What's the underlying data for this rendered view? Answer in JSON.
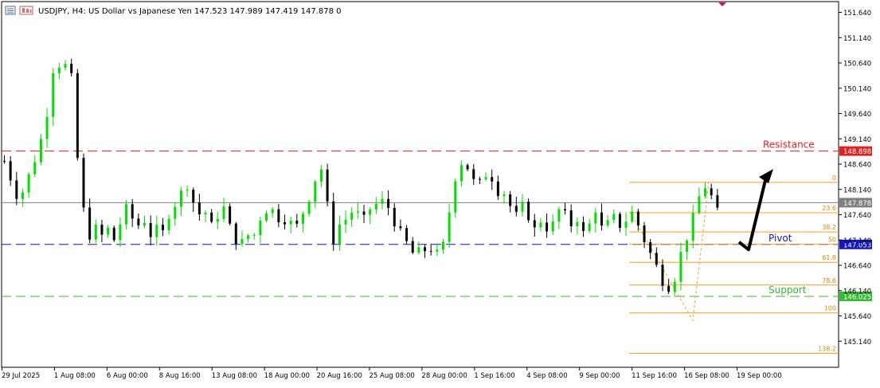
{
  "header": {
    "symbol_line": "USDJPY, H4:  US Dollar vs Japanese Yen  147.523 147.989 147.419 147.878  0",
    "icon_names": [
      "chart-window-icon",
      "chart-type-icon"
    ]
  },
  "chart_data": {
    "type": "candlestick",
    "symbol": "USDJPY",
    "timeframe": "H4",
    "ylim": [
      144.8,
      151.75
    ],
    "price_ticks": [
      "151.640",
      "151.140",
      "150.640",
      "150.140",
      "149.640",
      "149.140",
      "148.640",
      "148.140",
      "147.640",
      "147.140",
      "146.640",
      "146.140",
      "145.640",
      "145.140"
    ],
    "time_ticks": [
      "29 Jul 2025",
      "1 Aug 08:00",
      "6 Aug 00:00",
      "8 Aug 16:00",
      "13 Aug 08:00",
      "18 Aug 00:00",
      "20 Aug 16:00",
      "25 Aug 08:00",
      "28 Aug 00:00",
      "1 Sep 16:00",
      "4 Sep 08:00",
      "9 Sep 00:00",
      "11 Sep 16:00",
      "16 Sep 08:00",
      "19 Sep 00:00"
    ],
    "colors": {
      "bull": "#00e000",
      "bear": "#000000",
      "resistance": "#dd2222",
      "pivot": "#1515c8",
      "support": "#33bb33",
      "fib": "#f0a020",
      "current": "#808080"
    },
    "close_path": [
      [
        0,
        148.7
      ],
      [
        1.2,
        147.9
      ],
      [
        2,
        148.4
      ],
      [
        2.8,
        148.9
      ],
      [
        3.5,
        149.6
      ],
      [
        4,
        150.5
      ],
      [
        4.5,
        150.6
      ],
      [
        5,
        150.6
      ],
      [
        5.5,
        150.5
      ],
      [
        6.1,
        148.6
      ],
      [
        6.5,
        147.8
      ],
      [
        7,
        147.2
      ],
      [
        7.5,
        147.4
      ],
      [
        8,
        147.2
      ],
      [
        8.5,
        147.4
      ],
      [
        9,
        147.1
      ],
      [
        9.5,
        147.4
      ],
      [
        10,
        147.8
      ],
      [
        10.5,
        147.6
      ],
      [
        11,
        147.4
      ],
      [
        11.5,
        147.6
      ],
      [
        12,
        147.2
      ],
      [
        12.5,
        147.4
      ],
      [
        13,
        147.2
      ],
      [
        13.5,
        147.6
      ],
      [
        14,
        147.8
      ],
      [
        14.5,
        148.0
      ],
      [
        15,
        148.3
      ],
      [
        15.5,
        148.0
      ],
      [
        16,
        147.6
      ],
      [
        16.5,
        147.8
      ],
      [
        17,
        147.4
      ],
      [
        17.5,
        147.5
      ],
      [
        18,
        147.9
      ],
      [
        18.5,
        147.5
      ],
      [
        19,
        147.2
      ],
      [
        19.5,
        147.0
      ],
      [
        20,
        147.3
      ],
      [
        20.5,
        147.1
      ],
      [
        21,
        147.5
      ],
      [
        21.5,
        147.7
      ],
      [
        22,
        147.8
      ],
      [
        22.5,
        147.6
      ],
      [
        23,
        147.5
      ],
      [
        23.5,
        147.6
      ],
      [
        24,
        147.3
      ],
      [
        24.5,
        147.6
      ],
      [
        25,
        147.8
      ],
      [
        25.5,
        148.2
      ],
      [
        26,
        148.5
      ],
      [
        26.5,
        148.6
      ],
      [
        27,
        146.9
      ],
      [
        27.5,
        147.4
      ],
      [
        28,
        147.5
      ],
      [
        28.5,
        147.6
      ],
      [
        29,
        147.8
      ],
      [
        29.5,
        147.5
      ],
      [
        30,
        147.6
      ],
      [
        30.5,
        147.9
      ],
      [
        31,
        147.8
      ],
      [
        31.5,
        148.0
      ],
      [
        32,
        147.6
      ],
      [
        32.5,
        147.4
      ],
      [
        33,
        147.2
      ],
      [
        33.5,
        147.0
      ],
      [
        34,
        146.8
      ],
      [
        34.5,
        147.0
      ],
      [
        35,
        146.9
      ],
      [
        35.5,
        147.0
      ],
      [
        36,
        146.8
      ],
      [
        36.5,
        147.2
      ],
      [
        37,
        148.0
      ],
      [
        37.5,
        148.6
      ],
      [
        38,
        148.7
      ],
      [
        38.5,
        148.5
      ],
      [
        39,
        148.2
      ],
      [
        39.5,
        148.3
      ],
      [
        40,
        148.5
      ],
      [
        40.5,
        148.3
      ],
      [
        41,
        148.0
      ],
      [
        41.5,
        148.1
      ],
      [
        42,
        147.7
      ],
      [
        42.5,
        147.6
      ],
      [
        43,
        147.9
      ],
      [
        43.5,
        147.5
      ],
      [
        44,
        147.3
      ],
      [
        44.5,
        147.6
      ],
      [
        45,
        147.3
      ],
      [
        45.5,
        147.5
      ],
      [
        46,
        147.8
      ],
      [
        46.5,
        147.6
      ],
      [
        47,
        147.4
      ],
      [
        47.5,
        147.6
      ],
      [
        48,
        147.2
      ],
      [
        48.5,
        147.5
      ],
      [
        49,
        147.8
      ],
      [
        49.5,
        147.3
      ],
      [
        50,
        147.5
      ],
      [
        50.5,
        147.6
      ],
      [
        51,
        147.4
      ],
      [
        52,
        147.7
      ],
      [
        53,
        147.1
      ],
      [
        54,
        146.6
      ],
      [
        54.5,
        146.3
      ],
      [
        55,
        146.2
      ],
      [
        55.5,
        146.4
      ],
      [
        56,
        146.9
      ],
      [
        56.5,
        147.2
      ],
      [
        57,
        147.6
      ],
      [
        57.5,
        148.0
      ],
      [
        58,
        148.2
      ],
      [
        58.5,
        148.0
      ],
      [
        59,
        147.7
      ]
    ],
    "levels": [
      {
        "name": "resistance",
        "label": "Resistance",
        "price": 148.898,
        "value_text": "148.898"
      },
      {
        "name": "pivot",
        "label": "Pivot",
        "price": 147.053,
        "value_text": "147.053"
      },
      {
        "name": "support",
        "label": "Support",
        "price": 146.025,
        "value_text": "146.025"
      }
    ],
    "current_price": {
      "price": 147.878,
      "value_text": "147.878"
    },
    "fibonacci": {
      "swing_high": 148.28,
      "swing_low": 145.55,
      "levels": [
        {
          "label": "0",
          "price": 148.28
        },
        {
          "label": "23.6",
          "price": 147.68
        },
        {
          "label": "38.2",
          "price": 147.3
        },
        {
          "label": "50",
          "price": 147.06
        },
        {
          "label": "61.8",
          "price": 146.7
        },
        {
          "label": "78.6",
          "price": 146.25
        },
        {
          "label": "100",
          "price": 145.7
        },
        {
          "label": "138.2",
          "price": 144.9
        }
      ]
    },
    "forecast_arrow": {
      "from_price": 147.1,
      "via_price": 146.95,
      "to_price": 148.45
    }
  }
}
